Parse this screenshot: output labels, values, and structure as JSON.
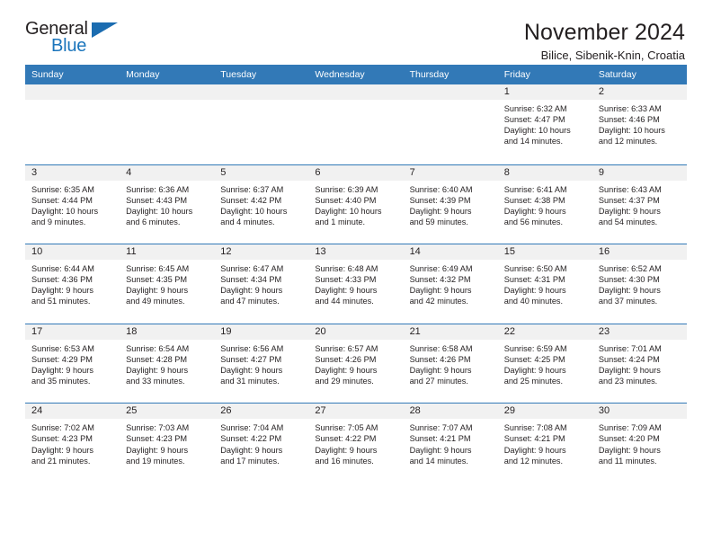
{
  "brand": {
    "name_part1": "General",
    "name_part2": "Blue",
    "accent_color": "#1b75bc"
  },
  "header": {
    "title": "November 2024",
    "subtitle": "Bilice, Sibenik-Knin, Croatia"
  },
  "theme": {
    "header_bar_color": "#3279b7",
    "day_band_color": "#f1f1f1",
    "text_color": "#231f20"
  },
  "weekdays": [
    "Sunday",
    "Monday",
    "Tuesday",
    "Wednesday",
    "Thursday",
    "Friday",
    "Saturday"
  ],
  "weeks": [
    [
      {
        "day": "",
        "empty": true
      },
      {
        "day": "",
        "empty": true
      },
      {
        "day": "",
        "empty": true
      },
      {
        "day": "",
        "empty": true
      },
      {
        "day": "",
        "empty": true
      },
      {
        "day": "1",
        "sunrise": "Sunrise: 6:32 AM",
        "sunset": "Sunset: 4:47 PM",
        "daylight_line1": "Daylight: 10 hours",
        "daylight_line2": "and 14 minutes."
      },
      {
        "day": "2",
        "sunrise": "Sunrise: 6:33 AM",
        "sunset": "Sunset: 4:46 PM",
        "daylight_line1": "Daylight: 10 hours",
        "daylight_line2": "and 12 minutes."
      }
    ],
    [
      {
        "day": "3",
        "sunrise": "Sunrise: 6:35 AM",
        "sunset": "Sunset: 4:44 PM",
        "daylight_line1": "Daylight: 10 hours",
        "daylight_line2": "and 9 minutes."
      },
      {
        "day": "4",
        "sunrise": "Sunrise: 6:36 AM",
        "sunset": "Sunset: 4:43 PM",
        "daylight_line1": "Daylight: 10 hours",
        "daylight_line2": "and 6 minutes."
      },
      {
        "day": "5",
        "sunrise": "Sunrise: 6:37 AM",
        "sunset": "Sunset: 4:42 PM",
        "daylight_line1": "Daylight: 10 hours",
        "daylight_line2": "and 4 minutes."
      },
      {
        "day": "6",
        "sunrise": "Sunrise: 6:39 AM",
        "sunset": "Sunset: 4:40 PM",
        "daylight_line1": "Daylight: 10 hours",
        "daylight_line2": "and 1 minute."
      },
      {
        "day": "7",
        "sunrise": "Sunrise: 6:40 AM",
        "sunset": "Sunset: 4:39 PM",
        "daylight_line1": "Daylight: 9 hours",
        "daylight_line2": "and 59 minutes."
      },
      {
        "day": "8",
        "sunrise": "Sunrise: 6:41 AM",
        "sunset": "Sunset: 4:38 PM",
        "daylight_line1": "Daylight: 9 hours",
        "daylight_line2": "and 56 minutes."
      },
      {
        "day": "9",
        "sunrise": "Sunrise: 6:43 AM",
        "sunset": "Sunset: 4:37 PM",
        "daylight_line1": "Daylight: 9 hours",
        "daylight_line2": "and 54 minutes."
      }
    ],
    [
      {
        "day": "10",
        "sunrise": "Sunrise: 6:44 AM",
        "sunset": "Sunset: 4:36 PM",
        "daylight_line1": "Daylight: 9 hours",
        "daylight_line2": "and 51 minutes."
      },
      {
        "day": "11",
        "sunrise": "Sunrise: 6:45 AM",
        "sunset": "Sunset: 4:35 PM",
        "daylight_line1": "Daylight: 9 hours",
        "daylight_line2": "and 49 minutes."
      },
      {
        "day": "12",
        "sunrise": "Sunrise: 6:47 AM",
        "sunset": "Sunset: 4:34 PM",
        "daylight_line1": "Daylight: 9 hours",
        "daylight_line2": "and 47 minutes."
      },
      {
        "day": "13",
        "sunrise": "Sunrise: 6:48 AM",
        "sunset": "Sunset: 4:33 PM",
        "daylight_line1": "Daylight: 9 hours",
        "daylight_line2": "and 44 minutes."
      },
      {
        "day": "14",
        "sunrise": "Sunrise: 6:49 AM",
        "sunset": "Sunset: 4:32 PM",
        "daylight_line1": "Daylight: 9 hours",
        "daylight_line2": "and 42 minutes."
      },
      {
        "day": "15",
        "sunrise": "Sunrise: 6:50 AM",
        "sunset": "Sunset: 4:31 PM",
        "daylight_line1": "Daylight: 9 hours",
        "daylight_line2": "and 40 minutes."
      },
      {
        "day": "16",
        "sunrise": "Sunrise: 6:52 AM",
        "sunset": "Sunset: 4:30 PM",
        "daylight_line1": "Daylight: 9 hours",
        "daylight_line2": "and 37 minutes."
      }
    ],
    [
      {
        "day": "17",
        "sunrise": "Sunrise: 6:53 AM",
        "sunset": "Sunset: 4:29 PM",
        "daylight_line1": "Daylight: 9 hours",
        "daylight_line2": "and 35 minutes."
      },
      {
        "day": "18",
        "sunrise": "Sunrise: 6:54 AM",
        "sunset": "Sunset: 4:28 PM",
        "daylight_line1": "Daylight: 9 hours",
        "daylight_line2": "and 33 minutes."
      },
      {
        "day": "19",
        "sunrise": "Sunrise: 6:56 AM",
        "sunset": "Sunset: 4:27 PM",
        "daylight_line1": "Daylight: 9 hours",
        "daylight_line2": "and 31 minutes."
      },
      {
        "day": "20",
        "sunrise": "Sunrise: 6:57 AM",
        "sunset": "Sunset: 4:26 PM",
        "daylight_line1": "Daylight: 9 hours",
        "daylight_line2": "and 29 minutes."
      },
      {
        "day": "21",
        "sunrise": "Sunrise: 6:58 AM",
        "sunset": "Sunset: 4:26 PM",
        "daylight_line1": "Daylight: 9 hours",
        "daylight_line2": "and 27 minutes."
      },
      {
        "day": "22",
        "sunrise": "Sunrise: 6:59 AM",
        "sunset": "Sunset: 4:25 PM",
        "daylight_line1": "Daylight: 9 hours",
        "daylight_line2": "and 25 minutes."
      },
      {
        "day": "23",
        "sunrise": "Sunrise: 7:01 AM",
        "sunset": "Sunset: 4:24 PM",
        "daylight_line1": "Daylight: 9 hours",
        "daylight_line2": "and 23 minutes."
      }
    ],
    [
      {
        "day": "24",
        "sunrise": "Sunrise: 7:02 AM",
        "sunset": "Sunset: 4:23 PM",
        "daylight_line1": "Daylight: 9 hours",
        "daylight_line2": "and 21 minutes."
      },
      {
        "day": "25",
        "sunrise": "Sunrise: 7:03 AM",
        "sunset": "Sunset: 4:23 PM",
        "daylight_line1": "Daylight: 9 hours",
        "daylight_line2": "and 19 minutes."
      },
      {
        "day": "26",
        "sunrise": "Sunrise: 7:04 AM",
        "sunset": "Sunset: 4:22 PM",
        "daylight_line1": "Daylight: 9 hours",
        "daylight_line2": "and 17 minutes."
      },
      {
        "day": "27",
        "sunrise": "Sunrise: 7:05 AM",
        "sunset": "Sunset: 4:22 PM",
        "daylight_line1": "Daylight: 9 hours",
        "daylight_line2": "and 16 minutes."
      },
      {
        "day": "28",
        "sunrise": "Sunrise: 7:07 AM",
        "sunset": "Sunset: 4:21 PM",
        "daylight_line1": "Daylight: 9 hours",
        "daylight_line2": "and 14 minutes."
      },
      {
        "day": "29",
        "sunrise": "Sunrise: 7:08 AM",
        "sunset": "Sunset: 4:21 PM",
        "daylight_line1": "Daylight: 9 hours",
        "daylight_line2": "and 12 minutes."
      },
      {
        "day": "30",
        "sunrise": "Sunrise: 7:09 AM",
        "sunset": "Sunset: 4:20 PM",
        "daylight_line1": "Daylight: 9 hours",
        "daylight_line2": "and 11 minutes."
      }
    ]
  ]
}
